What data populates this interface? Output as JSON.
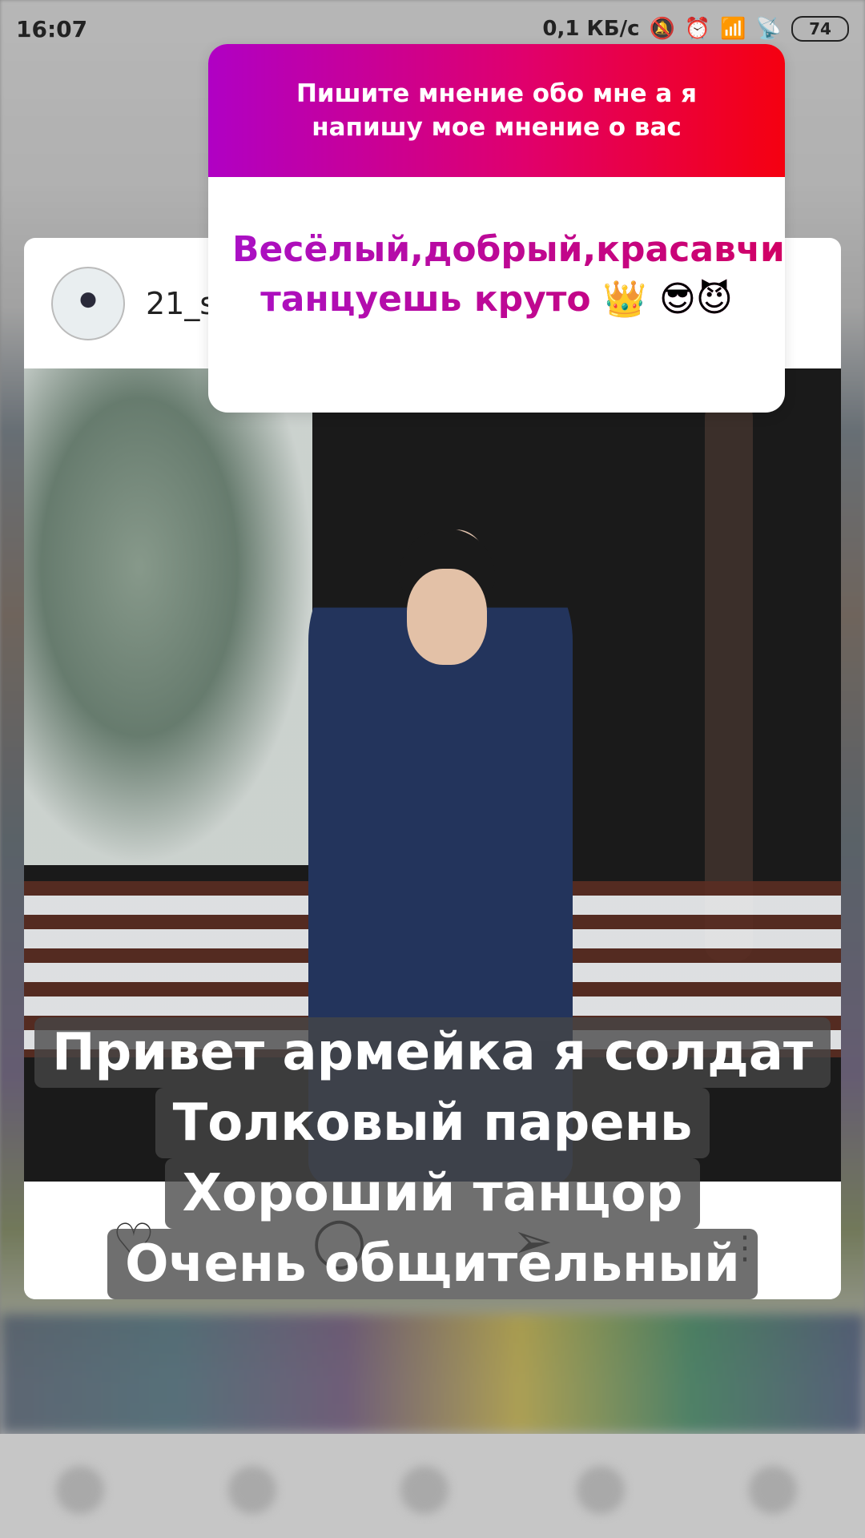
{
  "status_bar": {
    "time": "16:07",
    "network_speed": "0,1 КБ/с",
    "icons": [
      "mute-icon",
      "alarm-icon",
      "signal-icon",
      "wifi-icon"
    ],
    "battery": "74"
  },
  "post": {
    "username": "21_s",
    "actions": [
      "heart-icon",
      "comment-icon",
      "share-icon",
      "more-icon"
    ]
  },
  "question_sticker": {
    "prompt": "Пишите мнение обо мне а я напишу мое мнение о вас",
    "answer_text": "Весёлый,добрый,красавчик, танцуешь круто",
    "answer_emojis": "👑 😎😈",
    "gradient_colors": [
      "#b000c4",
      "#e0006c",
      "#f50010"
    ]
  },
  "caption": {
    "lines": [
      "Привет армейка я солдат",
      "Толковый парень",
      "Хороший танцор",
      "Очень общительный"
    ]
  }
}
